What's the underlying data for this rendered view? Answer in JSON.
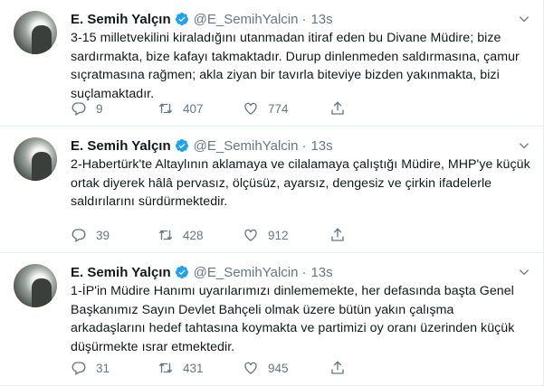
{
  "tweets": [
    {
      "name": "E. Semih Yalçın",
      "handle": "@E_SemihYalcin",
      "separator": "·",
      "time": "13s",
      "text": "3-15 milletvekilini kiraladığını utanmadan itiraf eden bu Divane Müdire; bize sardırmakta, bize kafayı takmaktadır. Durup dinlenmeden saldırmasına, çamur sıçratmasına rağmen; akla ziyan bir tavırla biteviye bizden yakınmakta, bizi suçlamaktadır.",
      "replies": "9",
      "retweets": "407",
      "likes": "774"
    },
    {
      "name": "E. Semih Yalçın",
      "handle": "@E_SemihYalcin",
      "separator": "·",
      "time": "13s",
      "text": "2-Habertürk'te Altaylının aklamaya ve cilalamaya çalıştığı Müdire, MHP'ye küçük ortak diyerek hâlâ pervasız, ölçüsüz, ayarsız, dengesiz ve çirkin ifadelerle saldırılarını sürdürmektedir.",
      "replies": "39",
      "retweets": "428",
      "likes": "912"
    },
    {
      "name": "E. Semih Yalçın",
      "handle": "@E_SemihYalcin",
      "separator": "·",
      "time": "13s",
      "text": "1-İP'in Müdire Hanımı uyarılarımızı dinlememekte, her defasında başta Genel Başkanımız Sayın Devlet Bahçeli olmak üzere bütün yakın çalışma arkadaşlarını hedef tahtasına koymakta ve partimizi oy oranı üzerinden küçük düşürmekte ısrar etmektedir.",
      "replies": "31",
      "retweets": "431",
      "likes": "945"
    }
  ],
  "colors": {
    "verified": "#1da1f2",
    "muted": "#657786",
    "text": "#14171a",
    "border": "#e6ecf0"
  },
  "icons": [
    "verified-icon",
    "caret-down-icon",
    "reply-icon",
    "retweet-icon",
    "like-icon",
    "share-icon"
  ]
}
